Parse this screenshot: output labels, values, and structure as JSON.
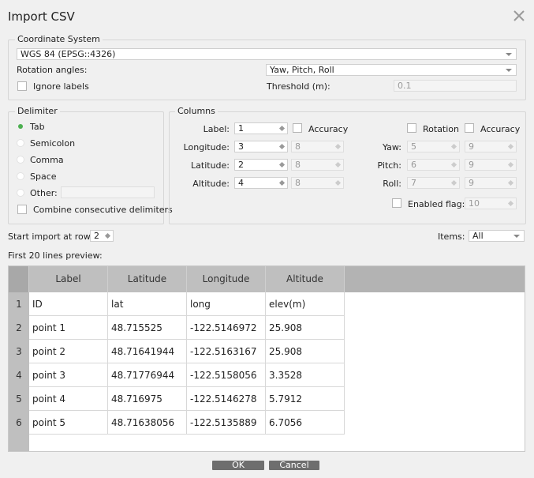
{
  "dialog": {
    "title": "Import CSV"
  },
  "coord": {
    "legend": "Coordinate System",
    "system_value": "WGS 84 (EPSG::4326)",
    "rotation_label": "Rotation angles:",
    "rotation_value": "Yaw, Pitch, Roll",
    "ignore_labels": "Ignore labels",
    "threshold_label": "Threshold (m):",
    "threshold_value": "0.1"
  },
  "delimiter": {
    "legend": "Delimiter",
    "options": [
      "Tab",
      "Semicolon",
      "Comma",
      "Space",
      "Other:"
    ],
    "selected": "Tab",
    "combine": "Combine consecutive delimiters"
  },
  "columns": {
    "legend": "Columns",
    "accuracy_label": "Accuracy",
    "rotation_label": "Rotation",
    "label": {
      "label": "Label:",
      "value": "1"
    },
    "longitude": {
      "label": "Longitude:",
      "value": "3",
      "acc": "8"
    },
    "latitude": {
      "label": "Latitude:",
      "value": "2",
      "acc": "8"
    },
    "altitude": {
      "label": "Altitude:",
      "value": "4",
      "acc": "8"
    },
    "yaw": {
      "label": "Yaw:",
      "value": "5",
      "acc": "9"
    },
    "pitch": {
      "label": "Pitch:",
      "value": "6",
      "acc": "9"
    },
    "roll": {
      "label": "Roll:",
      "value": "7",
      "acc": "9"
    },
    "enabled": {
      "label": "Enabled flag:",
      "value": "10"
    }
  },
  "import": {
    "start_label": "Start import at row:",
    "start_value": "2",
    "items_label": "Items:",
    "items_value": "All",
    "preview_label": "First 20 lines preview:"
  },
  "table": {
    "headers": [
      "Label",
      "Latitude",
      "Longitude",
      "Altitude"
    ],
    "rows": [
      [
        "ID",
        "lat",
        "long",
        "elev(m)"
      ],
      [
        "point 1",
        "48.715525",
        "-122.5146972",
        "25.908"
      ],
      [
        "point 2",
        "48.71641944",
        "-122.5163167",
        "25.908"
      ],
      [
        "point 3",
        "48.71776944",
        "-122.5158056",
        "3.3528"
      ],
      [
        "point 4",
        "48.716975",
        "-122.5146278",
        "5.7912"
      ],
      [
        "point 5",
        "48.71638056",
        "-122.5135889",
        "6.7056"
      ]
    ],
    "row_numbers": [
      "1",
      "2",
      "3",
      "4",
      "5",
      "6"
    ]
  },
  "buttons": {
    "ok": "OK",
    "cancel": "Cancel"
  },
  "colors": {
    "accent_radio": "#4caf50",
    "header_bg": "#bfbfbf",
    "button_bg": "#6e6e6e"
  }
}
